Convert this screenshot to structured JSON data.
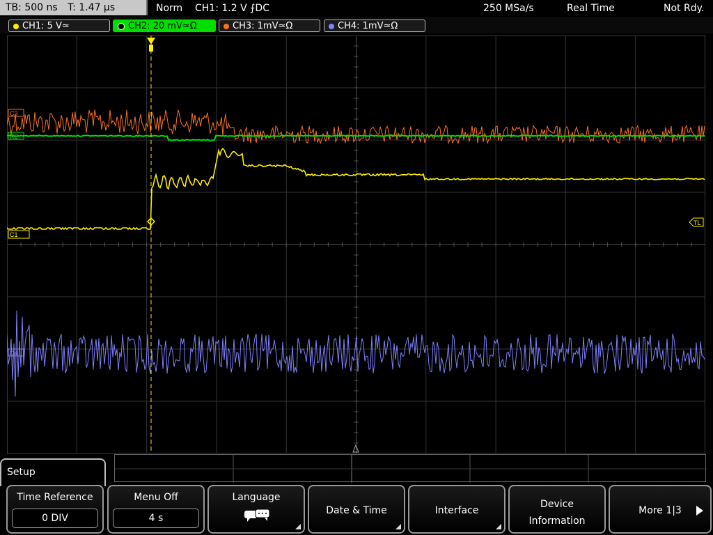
{
  "header": {
    "timebase": "TB: 500 ns",
    "trigger_time": "T: 1.47 µs",
    "mode": "Norm",
    "trigger_setting": "CH1: 1.2 V ⨍DC",
    "sample_rate": "250 MSa/s",
    "acq_mode": "Real Time",
    "status": "Not Rdy."
  },
  "channels": [
    {
      "label": "CH1: 5 V≃",
      "color": "#ffee00",
      "active": false
    },
    {
      "label": "CH2: 20 mV≃Ω",
      "color": "#00e000",
      "active": true
    },
    {
      "label": "CH3: 1mV≃Ω",
      "color": "#ff7020",
      "active": false
    },
    {
      "label": "CH4: 1mV≃Ω",
      "color": "#8080ff",
      "active": false
    }
  ],
  "markers": {
    "ch3": "C3",
    "ch2": "R2",
    "ch1": "C1",
    "ch4": "C4",
    "trigger_level": "TL"
  },
  "menu": {
    "title": "Setup",
    "softkeys": {
      "time_reference": {
        "label": "Time Reference",
        "value": "0 DIV"
      },
      "menu_off": {
        "label": "Menu Off",
        "value": "4 s"
      },
      "language": {
        "label": "Language"
      },
      "date_time": {
        "label": "Date & Time"
      },
      "interface": {
        "label": "Interface"
      },
      "device_info": {
        "line1": "Device",
        "line2": "Information"
      },
      "more": {
        "label": "More 1|3"
      }
    }
  },
  "icons": {
    "language": "speech-bubbles-icon",
    "more_arrow": "play-arrow-icon",
    "trigger": "trigger-position-icon"
  }
}
